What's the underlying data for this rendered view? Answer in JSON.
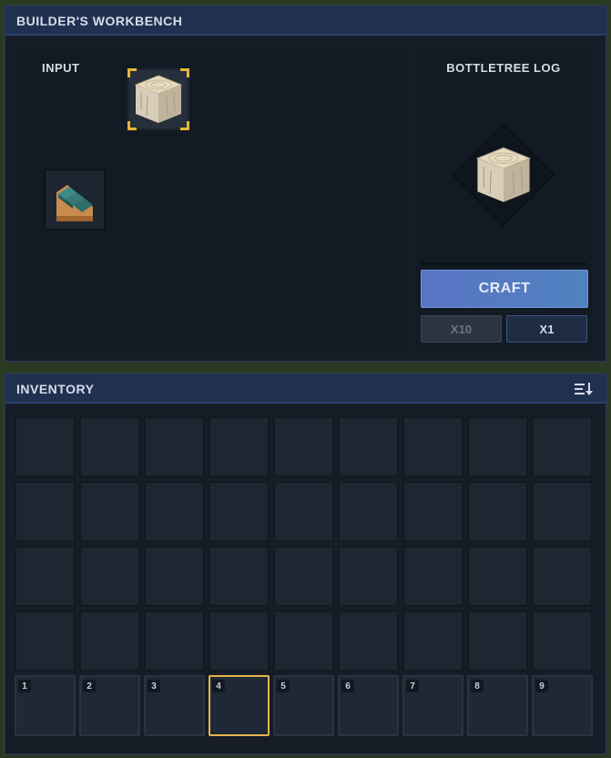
{
  "workbench": {
    "title": "BUILDER'S WORKBENCH",
    "input_label": "INPUT",
    "input_items": [
      {
        "icon": "bottletree-log-icon",
        "selected": true
      },
      {
        "icon": "teal-stairs-icon",
        "selected": false
      }
    ],
    "output": {
      "title": "BOTTLETREE LOG",
      "icon": "bottletree-log-icon"
    },
    "craft_label": "CRAFT",
    "qty_options": [
      {
        "label": "X10",
        "enabled": false
      },
      {
        "label": "X1",
        "enabled": true
      }
    ]
  },
  "inventory": {
    "title": "INVENTORY",
    "sort_icon": "sort-icon",
    "rows": 5,
    "columns": 9,
    "hotbar": [
      "1",
      "2",
      "3",
      "4",
      "5",
      "6",
      "7",
      "8",
      "9"
    ],
    "selected_hotbar_slot": 4
  },
  "colors": {
    "accent_gold": "#e7b73a",
    "header_blue": "#1f3050",
    "craft_blue": "#5a74c4"
  }
}
